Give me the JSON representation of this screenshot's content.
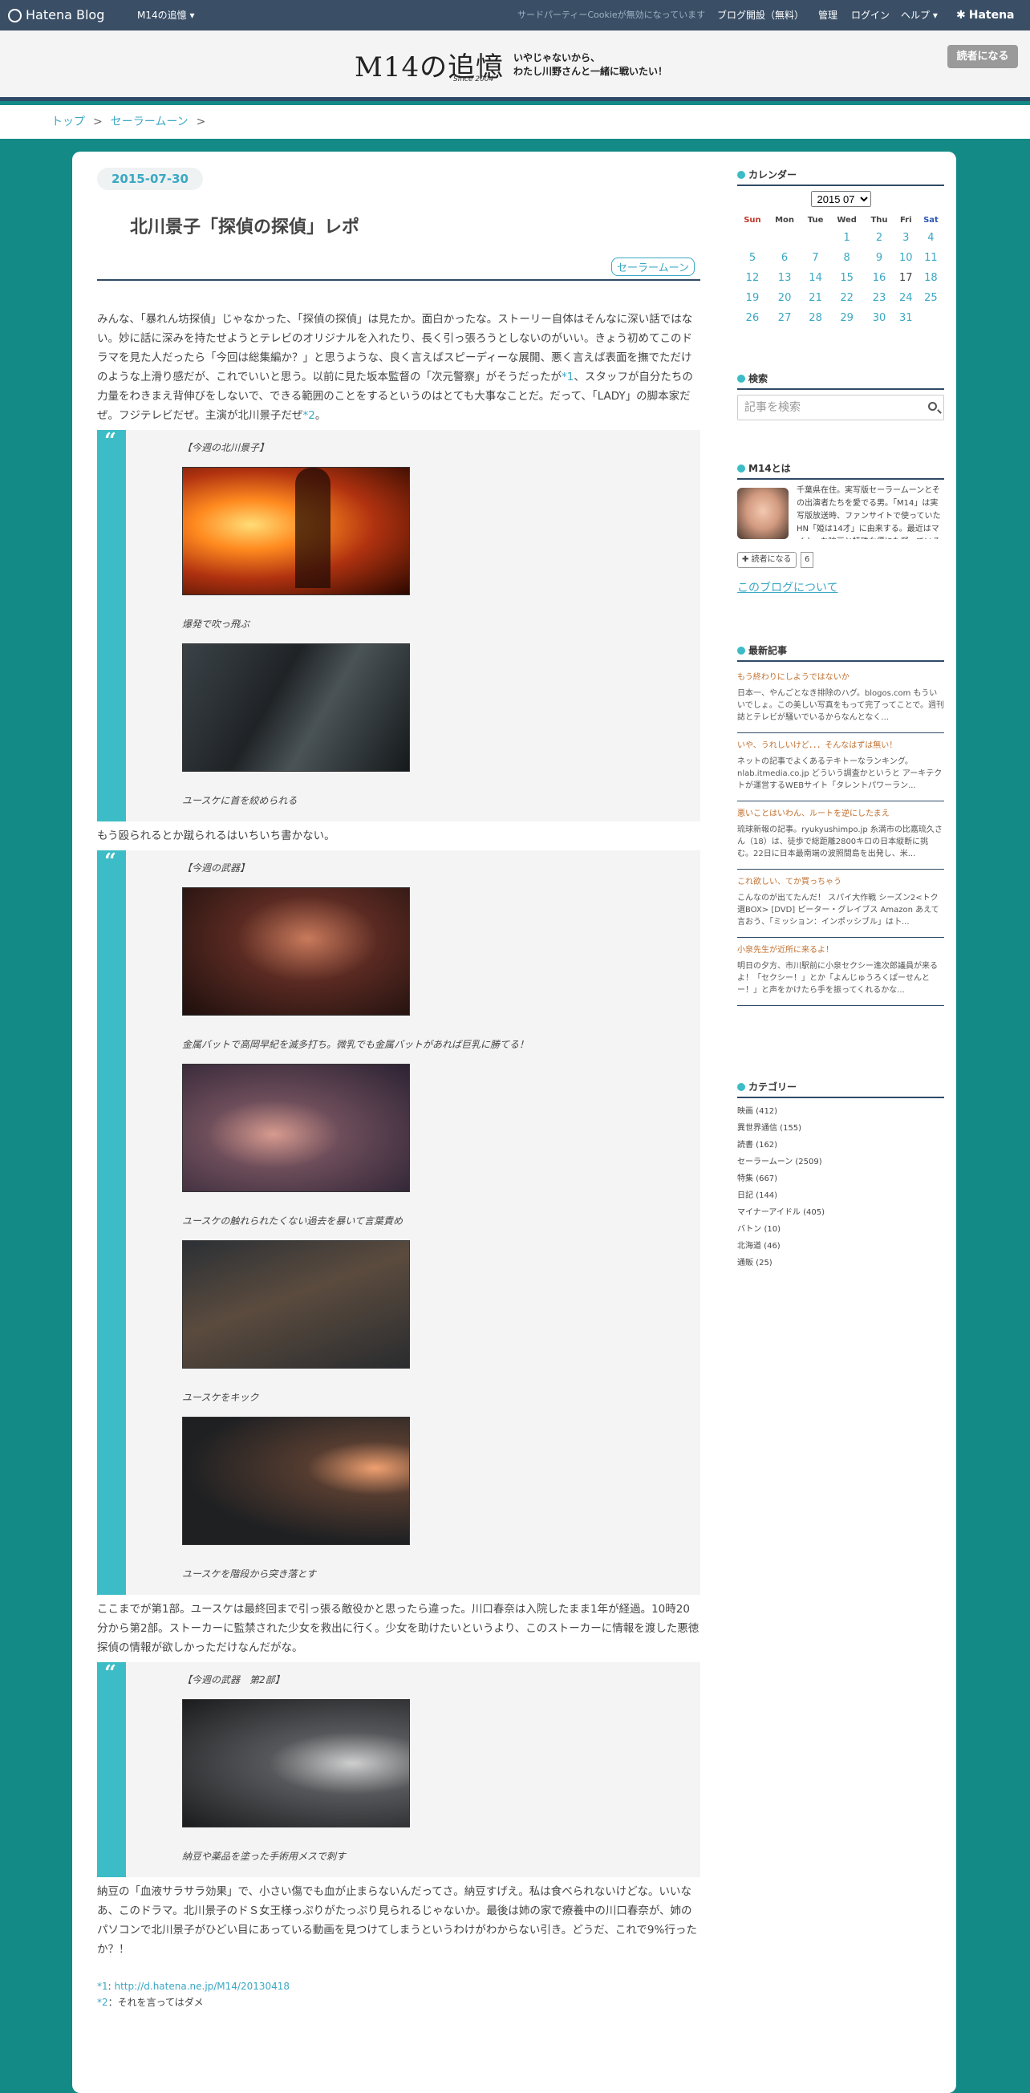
{
  "topbar": {
    "brand": "Hatena Blog",
    "blog_menu": "M14の追憶 ▾",
    "cookie_notice": "サードパーティーCookieが無効になっています",
    "start_blog": "ブログ開設（無料）",
    "admin": "管理",
    "login": "ログイン",
    "help": "ヘルプ ▾",
    "hatena": "Hatena"
  },
  "header": {
    "logo": "M14の追憶",
    "since": "Since 2004",
    "tagline_1": "いやじゃないから、",
    "tagline_2": "わたし川野さんと一緒に戦いたい！",
    "subscribe": "読者になる"
  },
  "breadcrumb": {
    "top": "トップ",
    "category": "セーラームーン",
    "sep": ">"
  },
  "article": {
    "date": "2015-07-30",
    "title": "北川景子「探偵の探偵」レポ",
    "category": "セーラームーン",
    "p1": "みんな、「暴れん坊探偵」じゃなかった、「探偵の探偵」は見たか。面白かったな。ストーリー自体はそんなに深い話ではない。妙に話に深みを持たせようとテレビのオリジナルを入れたり、長く引っ張ろうとしないのがいい。きょう初めてこのドラマを見た人だったら「今回は総集編か？」と思うような、良く言えばスピーディーな展開、悪く言えば表面を撫でただけのような上滑り感だが、これでいいと思う。以前に見た坂本監督の「次元警察」がそうだったが",
    "fn1": "*1",
    "p1b": "、スタッフが自分たちの力量をわきまえ背伸びをしないで、できる範囲のことをするというのはとても大事なことだ。だって、「LADY」の脚本家だぜ。フジテレビだぜ。主演が北川景子だぜ",
    "fn2": "*2",
    "p1c": "。",
    "q1_head": "【今週の北川景子】",
    "q1_cap1": "爆発で吹っ飛ぶ",
    "q1_cap2": "ユースケに首を絞められる",
    "p2": "もう殴られるとか蹴られるはいちいち書かない。",
    "q2_head": "【今週の武器】",
    "q2_cap1": "金属バットで高岡早紀を滅多打ち。微乳でも金属バットがあれば巨乳に勝てる！",
    "q2_cap2": "ユースケの触れられたくない過去を暴いて言葉責め",
    "q2_cap3": "ユースケをキック",
    "q2_cap4": "ユースケを階段から突き落とす",
    "p3": "ここまでが第1部。ユースケは最終回まで引っ張る敵役かと思ったら違った。川口春奈は入院したまま1年が経過。10時20分から第2部。ストーカーに監禁された少女を救出に行く。少女を助けたいというより、このストーカーに情報を渡した悪徳探偵の情報が欲しかっただけなんだがな。",
    "q3_head": "【今週の武器　第2部】",
    "q3_cap1": "納豆や薬品を塗った手術用メスで刺す",
    "p4": "納豆の「血液サラサラ効果」で、小さい傷でも血が止まらないんだってさ。納豆すげえ。私は食べられないけどな。いいなあ、このドラマ。北川景子のドＳ女王様っぷりがたっぷり見られるじゃないか。最後は姉の家で療養中の川口春奈が、姉のパソコンで北川景子がひどい目にあっている動画を見つけてしまうというわけがわからない引き。どうだ、これで9%行ったか？！",
    "fn_label1": "*1",
    "fn_url": "http://d.hatena.ne.jp/M14/20130418",
    "fn_label2": "*2",
    "fn_text2": "：それを言ってはダメ"
  },
  "sidebar": {
    "calendar": {
      "title": "カレンダー",
      "month": "2015 07",
      "weekdays": [
        "Sun",
        "Mon",
        "Tue",
        "Wed",
        "Thu",
        "Fri",
        "Sat"
      ],
      "weeks": [
        [
          "",
          "",
          "",
          "1",
          "2",
          "3",
          "4"
        ],
        [
          "5",
          "6",
          "7",
          "8",
          "9",
          "10",
          "11"
        ],
        [
          "12",
          "13",
          "14",
          "15",
          "16",
          "17",
          "18"
        ],
        [
          "19",
          "20",
          "21",
          "22",
          "23",
          "24",
          "25"
        ],
        [
          "26",
          "27",
          "28",
          "29",
          "30",
          "31",
          ""
        ]
      ]
    },
    "search": {
      "title": "検索",
      "placeholder": "記事を検索"
    },
    "about": {
      "title": "M14とは",
      "text": "千葉県在住。実写版セーラームーンとその出演者たちを愛でる男。「M14」は実写版放送時、ファンサイトで使っていたHN「姫は14才」に由来する。最近はマイナーな映画と特殊女優にも凝っている",
      "subscribe": "読者になる",
      "count": "6",
      "link": "このブログについて"
    },
    "recent": {
      "title": "最新記事",
      "entries": [
        {
          "title": "もう終わりにしようではないか",
          "desc": "日本一、やんごとなき排除のハグ。blogos.com もういいでしょ。この美しい写真をもって完了ってことで。週刊誌とテレビが騒いでいるからなんとなく..."
        },
        {
          "title": "いや、うれしいけど．．．そんなはずは無い！",
          "desc": "ネットの記事でよくあるテキトーなランキング。nlab.itmedia.co.jp どういう調査かというと アーキテクトが運営するWEBサイト「タレントパワーラン..."
        },
        {
          "title": "悪いことはいわん、ルートを逆にしたまえ",
          "desc": "琉球新報の記事。ryukyushimpo.jp 糸満市の比嘉琉久さん（18）は、徒歩で総距離2800キロの日本縦断に挑む。22日に日本最南端の波照間島を出発し、米..."
        },
        {
          "title": "これ欲しい、てか買っちゃう",
          "desc": "こんなのが出てたんだ！ スパイ大作戦 シーズン2<トク選BOX> [DVD] ピーター・グレイブス Amazon あえて言おう、「ミッション：インポッシブル」は卜..."
        },
        {
          "title": "小泉先生が近所に来るよ！",
          "desc": "明日の夕方、市川駅前に小泉セクシー進次郎議員が来るよ！「セクシー！」とか「よんじゅうろくぱーせんとー！」と声をかけたら手を振ってくれるかな..."
        }
      ]
    },
    "categories": {
      "title": "カテゴリー",
      "items": [
        "映画 (412)",
        "異世界通信 (155)",
        "読書 (162)",
        "セーラームーン (2509)",
        "特集 (667)",
        "日記 (144)",
        "マイナーアイドル (405)",
        "バトン (10)",
        "北海道 (46)",
        "通販 (25)"
      ]
    }
  }
}
